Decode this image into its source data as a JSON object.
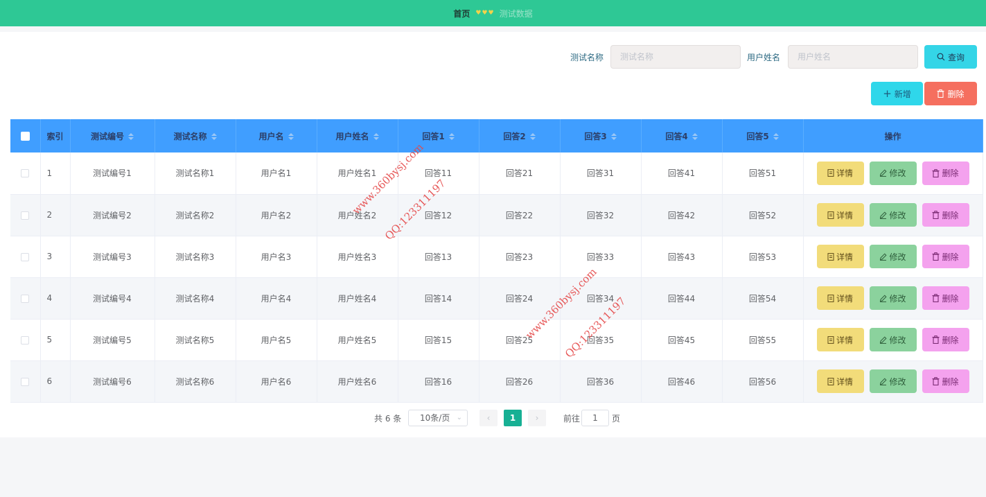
{
  "breadcrumb": {
    "home": "首页",
    "current": "测试数据"
  },
  "search": {
    "name_label": "测试名称",
    "name_placeholder": "测试名称",
    "user_label": "用户姓名",
    "user_placeholder": "用户姓名",
    "query_label": "查询"
  },
  "actions": {
    "add_label": "新增",
    "delete_label": "删除"
  },
  "table": {
    "headers": {
      "index": "索引",
      "test_no": "测试编号",
      "test_name": "测试名称",
      "username": "用户名",
      "real_name": "用户姓名",
      "a1": "回答1",
      "a2": "回答2",
      "a3": "回答3",
      "a4": "回答4",
      "a5": "回答5",
      "ops": "操作"
    },
    "rows": [
      {
        "index": "1",
        "test_no": "测试编号1",
        "test_name": "测试名称1",
        "username": "用户名1",
        "real_name": "用户姓名1",
        "a1": "回答11",
        "a2": "回答21",
        "a3": "回答31",
        "a4": "回答41",
        "a5": "回答51"
      },
      {
        "index": "2",
        "test_no": "测试编号2",
        "test_name": "测试名称2",
        "username": "用户名2",
        "real_name": "用户姓名2",
        "a1": "回答12",
        "a2": "回答22",
        "a3": "回答32",
        "a4": "回答42",
        "a5": "回答52"
      },
      {
        "index": "3",
        "test_no": "测试编号3",
        "test_name": "测试名称3",
        "username": "用户名3",
        "real_name": "用户姓名3",
        "a1": "回答13",
        "a2": "回答23",
        "a3": "回答33",
        "a4": "回答43",
        "a5": "回答53"
      },
      {
        "index": "4",
        "test_no": "测试编号4",
        "test_name": "测试名称4",
        "username": "用户名4",
        "real_name": "用户姓名4",
        "a1": "回答14",
        "a2": "回答24",
        "a3": "回答34",
        "a4": "回答44",
        "a5": "回答54"
      },
      {
        "index": "5",
        "test_no": "测试编号5",
        "test_name": "测试名称5",
        "username": "用户名5",
        "real_name": "用户姓名5",
        "a1": "回答15",
        "a2": "回答25",
        "a3": "回答35",
        "a4": "回答45",
        "a5": "回答55"
      },
      {
        "index": "6",
        "test_no": "测试编号6",
        "test_name": "测试名称6",
        "username": "用户名6",
        "real_name": "用户姓名6",
        "a1": "回答16",
        "a2": "回答26",
        "a3": "回答36",
        "a4": "回答46",
        "a5": "回答56"
      }
    ],
    "row_actions": {
      "detail": "详情",
      "edit": "修改",
      "delete": "删除"
    }
  },
  "pagination": {
    "total_text": "共 6 条",
    "page_size": "10条/页",
    "current_page": "1",
    "goto_label": "前往",
    "goto_value": "1",
    "goto_unit": "页"
  },
  "watermarks": [
    {
      "line1": "www.360bysj.com",
      "line2": "QQ:123311197"
    },
    {
      "line1": "www.360bysj.com",
      "line2": "QQ:123311197"
    }
  ],
  "icons": [
    "heart-icon",
    "search-icon",
    "plus-icon",
    "trash-icon",
    "document-icon",
    "pencil-icon",
    "chevron-left-icon",
    "chevron-right-icon",
    "chevron-down-icon"
  ],
  "colors": {
    "header_bar": "#2ec895",
    "table_head": "#409eff",
    "query_button": "#34d5e7",
    "delete_button": "#f56f5f",
    "active_page": "#17b094"
  }
}
